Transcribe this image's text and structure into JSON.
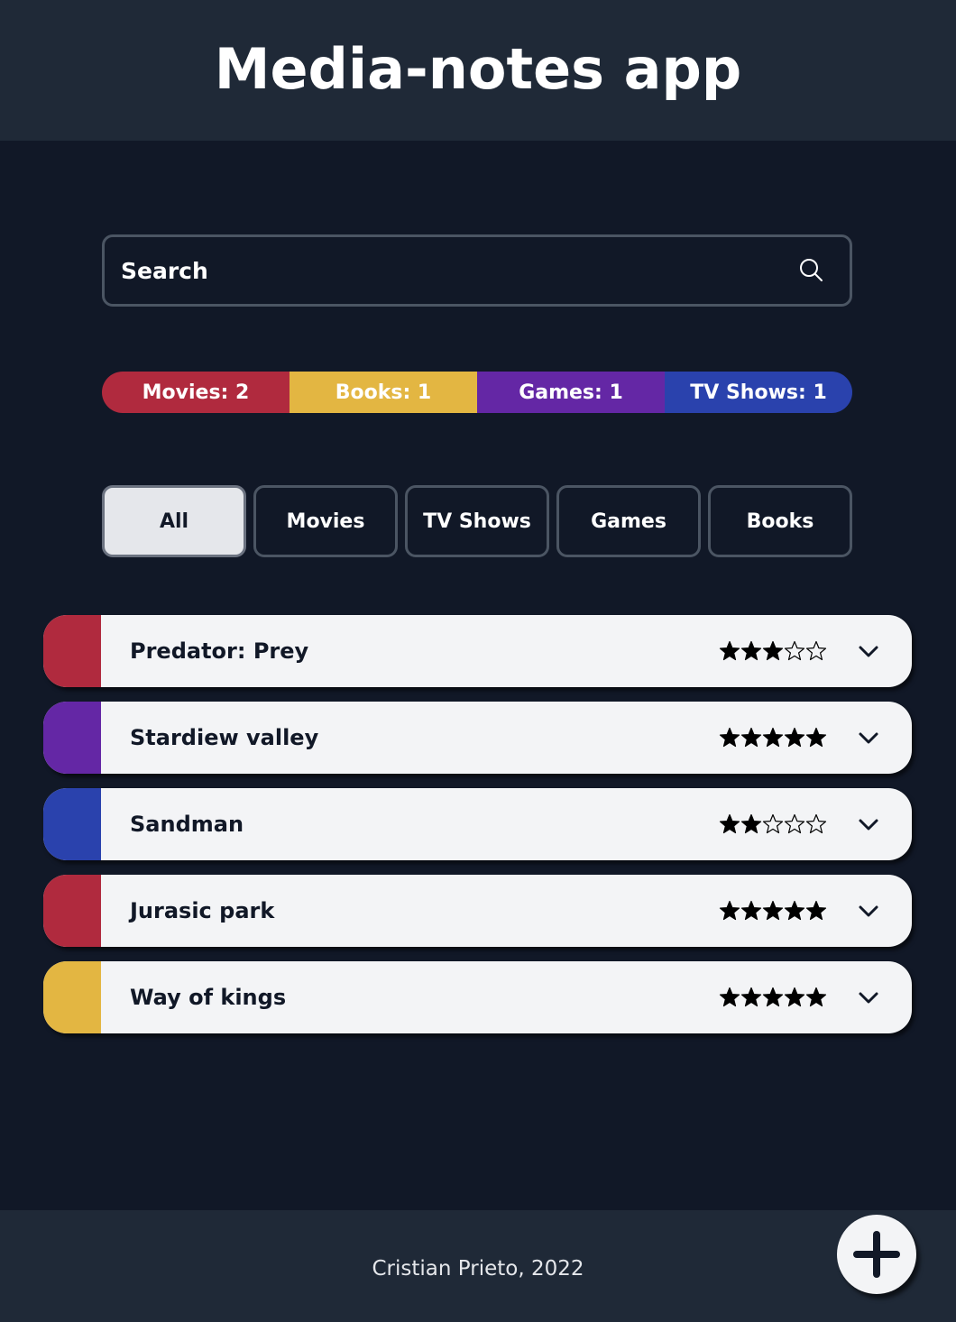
{
  "header": {
    "title": "Media-notes app"
  },
  "search": {
    "placeholder": "Search"
  },
  "stats": [
    {
      "label": "Movies: 2",
      "color": "#b02a3e"
    },
    {
      "label": "Books: 1",
      "color": "#e3b642"
    },
    {
      "label": "Games: 1",
      "color": "#6427a5"
    },
    {
      "label": "TV Shows: 1",
      "color": "#2a42ad"
    }
  ],
  "filters": [
    {
      "label": "All",
      "active": true
    },
    {
      "label": "Movies",
      "active": false
    },
    {
      "label": "TV Shows",
      "active": false
    },
    {
      "label": "Games",
      "active": false
    },
    {
      "label": "Books",
      "active": false
    }
  ],
  "items": [
    {
      "title": "Predator: Prey",
      "rating": 3,
      "max_rating": 5,
      "color": "#b02a3e"
    },
    {
      "title": "Stardiew valley",
      "rating": 5,
      "max_rating": 5,
      "color": "#6427a5"
    },
    {
      "title": "Sandman",
      "rating": 2,
      "max_rating": 5,
      "color": "#2a42ad"
    },
    {
      "title": "Jurasic park",
      "rating": 5,
      "max_rating": 5,
      "color": "#b02a3e"
    },
    {
      "title": "Way of kings",
      "rating": 5,
      "max_rating": 5,
      "color": "#e3b642"
    }
  ],
  "footer": {
    "credit": "Cristian Prieto, 2022"
  },
  "icons": {
    "search": "search-icon",
    "expand": "chevron-down-icon",
    "add": "plus-icon",
    "star": "star-icon"
  }
}
